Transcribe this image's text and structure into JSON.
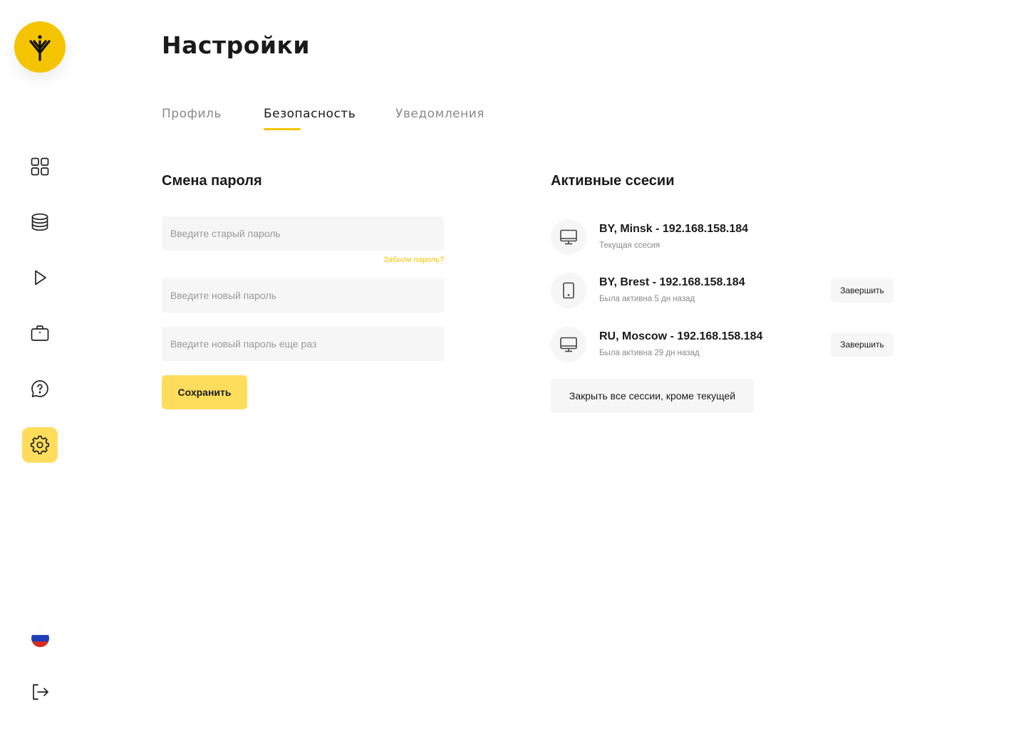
{
  "app": {
    "logo_icon": "tree-rune-logo",
    "accent_color": "#f5c400",
    "active_accent": "#ffdd5c"
  },
  "sidebar": {
    "items": [
      {
        "icon": "dashboard-grid-icon"
      },
      {
        "icon": "database-icon"
      },
      {
        "icon": "play-icon"
      },
      {
        "icon": "briefcase-icon"
      },
      {
        "icon": "help-chat-icon"
      },
      {
        "icon": "settings-gear-icon",
        "active": true
      }
    ],
    "language_flag": "russia-flag-icon",
    "logout_icon": "logout-icon"
  },
  "page": {
    "title": "Настройки"
  },
  "tabs": [
    {
      "label": "Профиль",
      "active": false
    },
    {
      "label": "Безопасность",
      "active": true
    },
    {
      "label": "Уведомления",
      "active": false
    }
  ],
  "password_change": {
    "title": "Смена пароля",
    "old_password_placeholder": "Введите старый пароль",
    "forgot_label": "Забыли пароль?",
    "new_password_placeholder": "Введите новый пароль",
    "repeat_password_placeholder": "Введите новый пароль еще раз",
    "save_label": "Сохранить"
  },
  "sessions": {
    "title": "Активные ссесии",
    "items": [
      {
        "device": "desktop-icon",
        "title": "BY, Minsk - 192.168.158.184",
        "subtitle": "Текущая ссесия",
        "end_label": ""
      },
      {
        "device": "tablet-icon",
        "title": "BY, Brest - 192.168.158.184",
        "subtitle": "Была активна 5 дн назад",
        "end_label": "Завершить"
      },
      {
        "device": "desktop-icon",
        "title": "RU, Moscow - 192.168.158.184",
        "subtitle": "Была активна 29 дн назад",
        "end_label": "Завершить"
      }
    ],
    "close_all_label": "Закрыть все сессии, кроме текущей"
  }
}
